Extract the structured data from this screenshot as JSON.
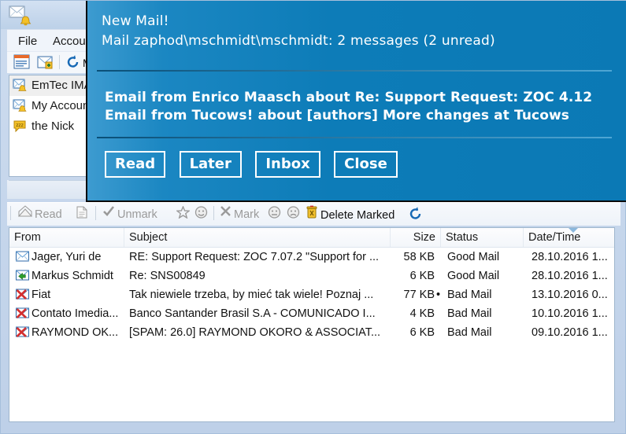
{
  "window": {
    "title_icon": "mail-alert-icon"
  },
  "menubar": {
    "items": [
      {
        "label": "File"
      },
      {
        "label": "Account"
      }
    ]
  },
  "toolbar_top": {
    "items": [
      {
        "icon": "message-list-icon"
      },
      {
        "icon": "new-account-icon"
      },
      {
        "icon": "refresh-icon",
        "label": "M"
      }
    ]
  },
  "accounts": {
    "items": [
      {
        "label": "EmTec IMA",
        "icon": "mail-bell-icon",
        "selected": true
      },
      {
        "label": "My Accoun",
        "icon": "mail-bell-icon",
        "selected": false
      },
      {
        "label": "the Nick",
        "icon": "zzz-bubble-icon",
        "selected": false
      }
    ]
  },
  "toolbar_mail": {
    "read_label": "Read",
    "unmark_label": "Unmark",
    "mark_label": "Mark",
    "delete_marked_label": "Delete Marked",
    "icons": [
      "open-envelope-icon",
      "document-icon",
      "check-icon",
      "star-icon",
      "smiley-happy-icon",
      "x-icon",
      "smiley-neutral-icon",
      "smiley-sad-icon",
      "trash-icon",
      "refresh-icon"
    ]
  },
  "mail_list": {
    "columns": [
      {
        "label": "From",
        "align": "left"
      },
      {
        "label": "Subject",
        "align": "left"
      },
      {
        "label": "Size",
        "align": "right"
      },
      {
        "label": "Status",
        "align": "left"
      },
      {
        "label": "Date/Time",
        "align": "left",
        "sorted": true
      }
    ],
    "rows": [
      {
        "icon": "envelope-blue-icon",
        "from": "Jager, Yuri de",
        "subject": "RE: Support Request: ZOC 7.07.2 \"Support for ...",
        "size": "58 KB",
        "marker": "",
        "status": "Good Mail",
        "date": "28.10.2016 1..."
      },
      {
        "icon": "envelope-reply-icon",
        "from": "Markus Schmidt",
        "subject": "Re: SNS00849",
        "size": "6 KB",
        "marker": "",
        "status": "Good Mail",
        "date": "28.10.2016 1..."
      },
      {
        "icon": "envelope-x-icon",
        "from": "Fiat",
        "subject": "Tak niewiele trzeba, by mieć tak wiele! Poznaj ...",
        "size": "77 KB",
        "marker": "•",
        "status": "Bad Mail",
        "date": "13.10.2016 0..."
      },
      {
        "icon": "envelope-x-icon",
        "from": "Contato Imedia...",
        "subject": "Banco Santander Brasil S.A - COMUNICADO I...",
        "size": "4 KB",
        "marker": "",
        "status": "Bad Mail",
        "date": "10.10.2016 1..."
      },
      {
        "icon": "envelope-x-icon",
        "from": "RAYMOND OK...",
        "subject": "[SPAM: 26.0] RAYMOND OKORO & ASSOCIAT...",
        "size": "6 KB",
        "marker": "",
        "status": "Bad Mail",
        "date": "09.10.2016 1..."
      }
    ]
  },
  "notification": {
    "title": "New Mail!",
    "subtitle": "Mail zaphod\\mschmidt\\mschmidt: 2 messages (2 unread)",
    "messages": [
      "Email from Enrico Maasch about Re: Support Request: ZOC 4.12",
      "Email from Tucows! about [authors] More changes at Tucows"
    ],
    "buttons": [
      {
        "label": "Read"
      },
      {
        "label": "Later"
      },
      {
        "label": "Inbox"
      },
      {
        "label": "Close"
      }
    ],
    "accent_color": "#0b79b5"
  }
}
